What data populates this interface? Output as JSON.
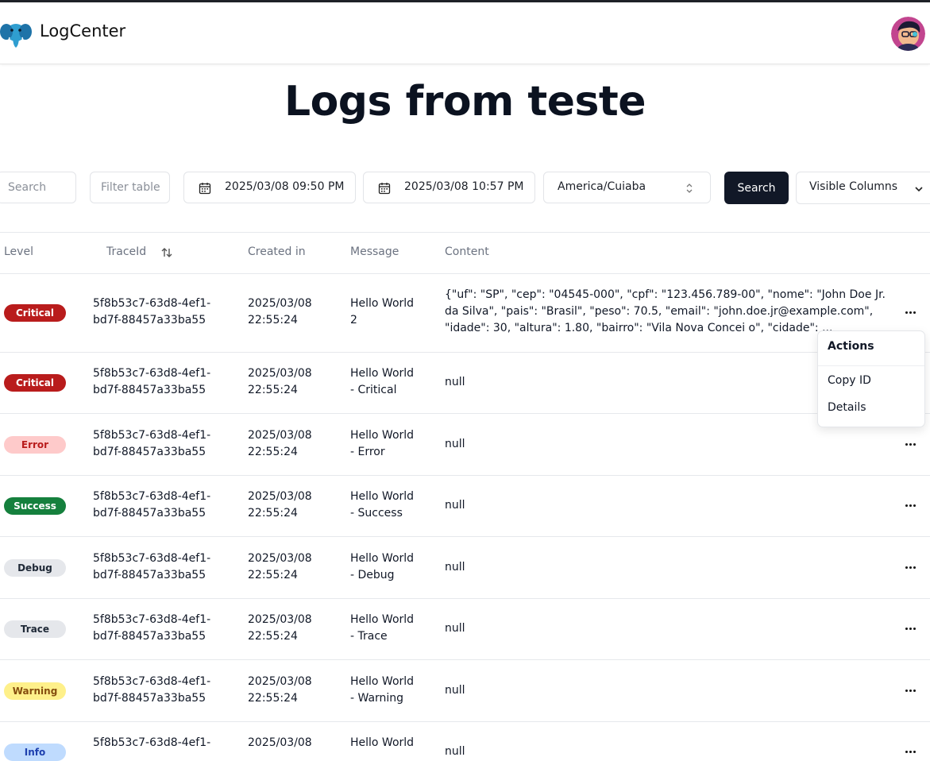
{
  "app": {
    "brand": "LogCenter"
  },
  "page": {
    "title": "Logs from teste"
  },
  "filters": {
    "search_placeholder": "Search",
    "filter_placeholder": "Filter table",
    "start_date": "2025/03/08 09:50 PM",
    "end_date": "2025/03/08 10:57 PM",
    "timezone": "America/Cuiaba",
    "search_button": "Search",
    "visible_columns": "Visible Columns"
  },
  "table": {
    "columns": [
      "Level",
      "TraceId",
      "Created in",
      "Message",
      "Content"
    ],
    "rows": [
      {
        "level": "Critical",
        "trace1": "5f8b53c7-63d8-4ef1-",
        "trace2": "bd7f-88457a33ba55",
        "date1": "2025/03/08",
        "date2": "22:55:24",
        "msg1": "Hello World",
        "msg2": "2",
        "content1": "{\"uf\": \"SP\", \"cep\": \"04545-000\", \"cpf\": \"123.456.789-00\", \"nome\": \"John Doe Jr.",
        "content2": "da Silva\", \"pais\": \"Brasil\", \"peso\": 70.5, \"email\": \"john.doe.jr@example.com\",",
        "content3": "\"idade\": 30, \"altura\": 1.80, \"bairro\": \"Vila Nova Concei o\", \"cidade\": ..."
      },
      {
        "level": "Critical",
        "trace1": "5f8b53c7-63d8-4ef1-",
        "trace2": "bd7f-88457a33ba55",
        "date1": "2025/03/08",
        "date2": "22:55:24",
        "msg1": "Hello World",
        "msg2": "- Critical",
        "content1": "null"
      },
      {
        "level": "Error",
        "trace1": "5f8b53c7-63d8-4ef1-",
        "trace2": "bd7f-88457a33ba55",
        "date1": "2025/03/08",
        "date2": "22:55:24",
        "msg1": "Hello World",
        "msg2": "- Error",
        "content1": "null"
      },
      {
        "level": "Success",
        "trace1": "5f8b53c7-63d8-4ef1-",
        "trace2": "bd7f-88457a33ba55",
        "date1": "2025/03/08",
        "date2": "22:55:24",
        "msg1": "Hello World",
        "msg2": "- Success",
        "content1": "null"
      },
      {
        "level": "Debug",
        "trace1": "5f8b53c7-63d8-4ef1-",
        "trace2": "bd7f-88457a33ba55",
        "date1": "2025/03/08",
        "date2": "22:55:24",
        "msg1": "Hello World",
        "msg2": "- Debug",
        "content1": "null"
      },
      {
        "level": "Trace",
        "trace1": "5f8b53c7-63d8-4ef1-",
        "trace2": "bd7f-88457a33ba55",
        "date1": "2025/03/08",
        "date2": "22:55:24",
        "msg1": "Hello World",
        "msg2": "- Trace",
        "content1": "null"
      },
      {
        "level": "Warning",
        "trace1": "5f8b53c7-63d8-4ef1-",
        "trace2": "bd7f-88457a33ba55",
        "date1": "2025/03/08",
        "date2": "22:55:24",
        "msg1": "Hello World",
        "msg2": "- Warning",
        "content1": "null"
      },
      {
        "level": "Info",
        "trace1": "5f8b53c7-63d8-4ef1-",
        "trace2": "",
        "date1": "2025/03/08",
        "date2": "",
        "msg1": "Hello World",
        "msg2": "",
        "content1": "null"
      }
    ]
  },
  "level_colors": {
    "Critical": {
      "bg": "#b91c1c",
      "fg": "#ffffff"
    },
    "Error": {
      "bg": "#fecaca",
      "fg": "#b91c1c"
    },
    "Success": {
      "bg": "#15803d",
      "fg": "#ffffff"
    },
    "Debug": {
      "bg": "#e5e7eb",
      "fg": "#1f2937"
    },
    "Trace": {
      "bg": "#e5e7eb",
      "fg": "#1f2937"
    },
    "Warning": {
      "bg": "#fef08a",
      "fg": "#854d0e"
    },
    "Info": {
      "bg": "#bfdbfe",
      "fg": "#1e40af"
    }
  },
  "actions_menu": {
    "title": "Actions",
    "items": [
      "Copy ID",
      "Details"
    ]
  },
  "icons": [
    "elephant-logo-icon",
    "avatar-icon",
    "calendar-icon",
    "chevron-up-down-icon",
    "chevron-down-icon",
    "sort-icon",
    "more-horizontal-icon"
  ]
}
